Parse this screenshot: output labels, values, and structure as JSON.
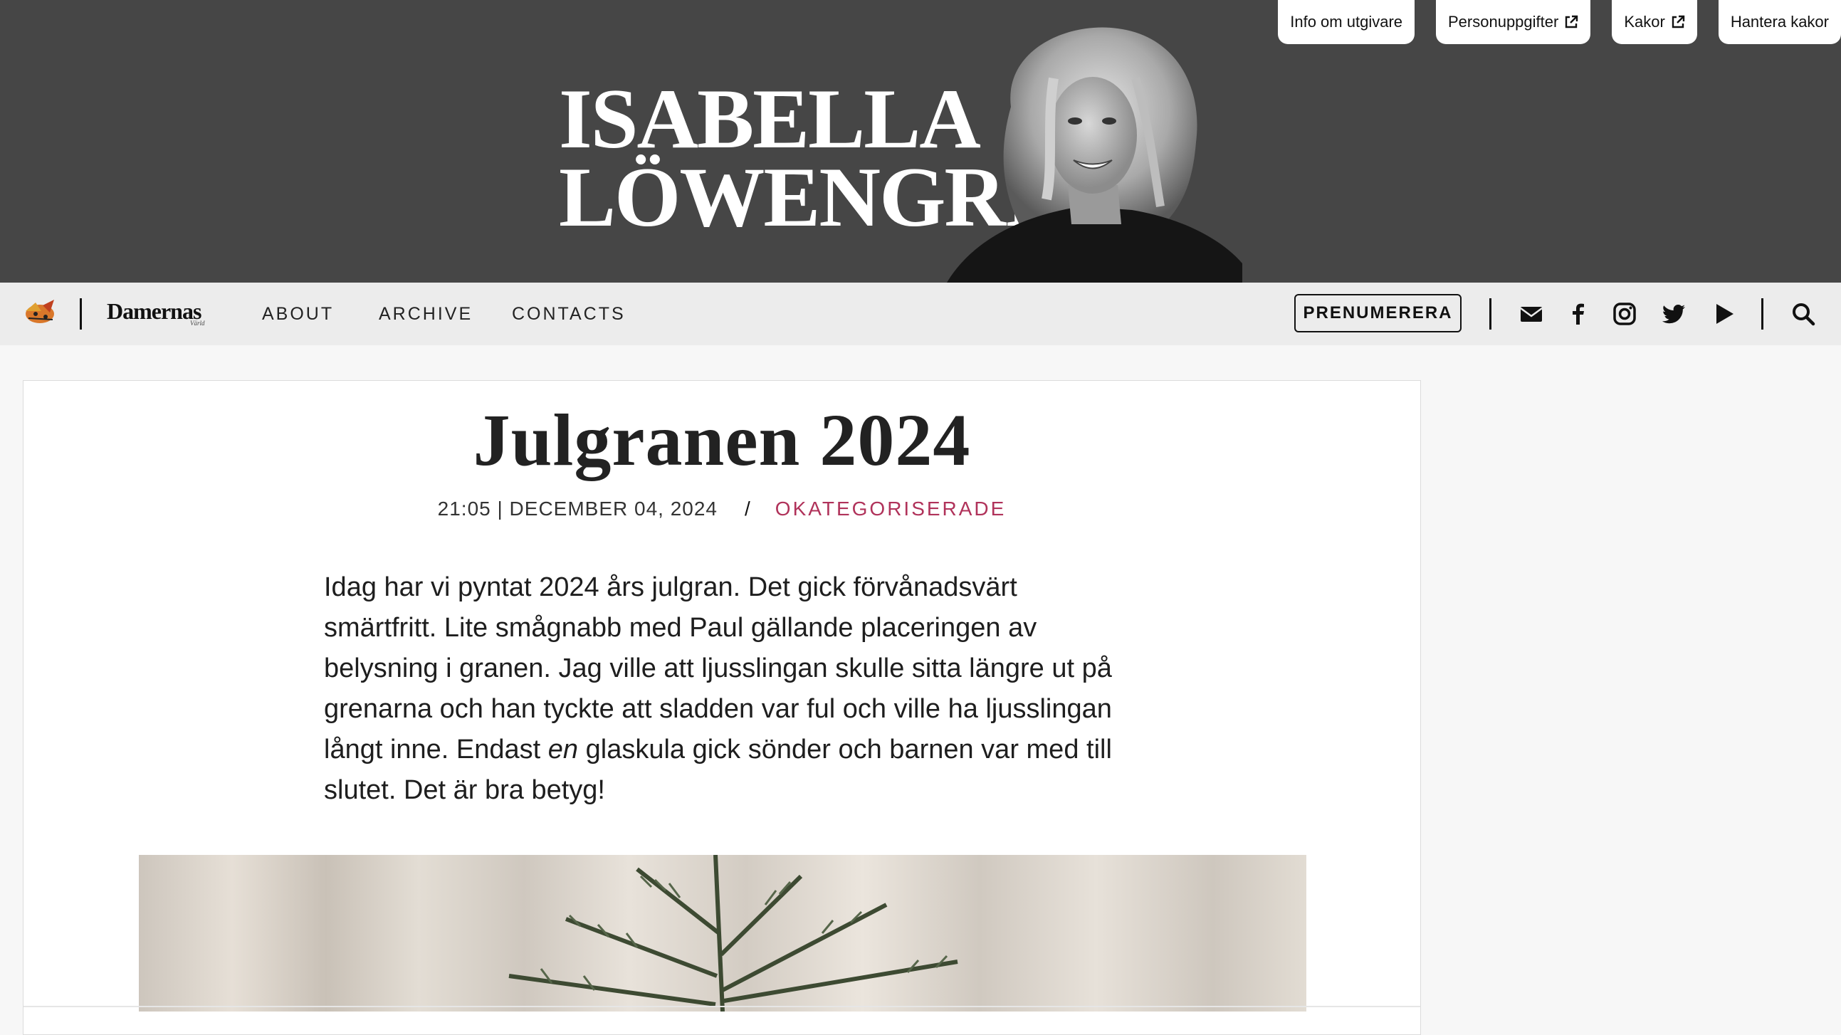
{
  "header": {
    "site_title_line1": "ISABELLA",
    "site_title_line2": "LÖWENGRIP",
    "top_links": [
      {
        "label": "Info om utgivare",
        "external": false
      },
      {
        "label": "Personuppgifter",
        "external": true
      },
      {
        "label": "Kakor",
        "external": true
      },
      {
        "label": "Hantera kakor",
        "external": false
      }
    ]
  },
  "nav": {
    "brand": "Damernas",
    "brand_sub": "Värld",
    "menu": [
      "ABOUT",
      "ARCHIVE",
      "CONTACTS"
    ],
    "subscribe_label": "PRENUMERERA",
    "icons": [
      "envelope-icon",
      "facebook-icon",
      "instagram-icon",
      "twitter-icon",
      "youtube-play-icon",
      "search-icon"
    ]
  },
  "post": {
    "title": "Julgranen 2024",
    "datetime": "21:05 | DECEMBER 04, 2024",
    "separator": "/",
    "category": "OKATEGORISERADE",
    "body_before_em": "Idag har vi pyntat 2024 års julgran. Det gick förvånadsvärt smärtfritt. Lite smågnabb med Paul gällande placeringen av belysning i granen. Jag ville att ljusslingan skulle sitta längre ut på grenarna och han tyckte att sladden var ful och ville ha ljusslingan långt inne. Endast ",
    "body_em": "en",
    "body_after_em": " glaskula gick sönder och barnen var med till slutet. Det är bra betyg!"
  },
  "colors": {
    "header_bg": "#464646",
    "nav_bg": "#ececec",
    "category": "#b0325a"
  }
}
